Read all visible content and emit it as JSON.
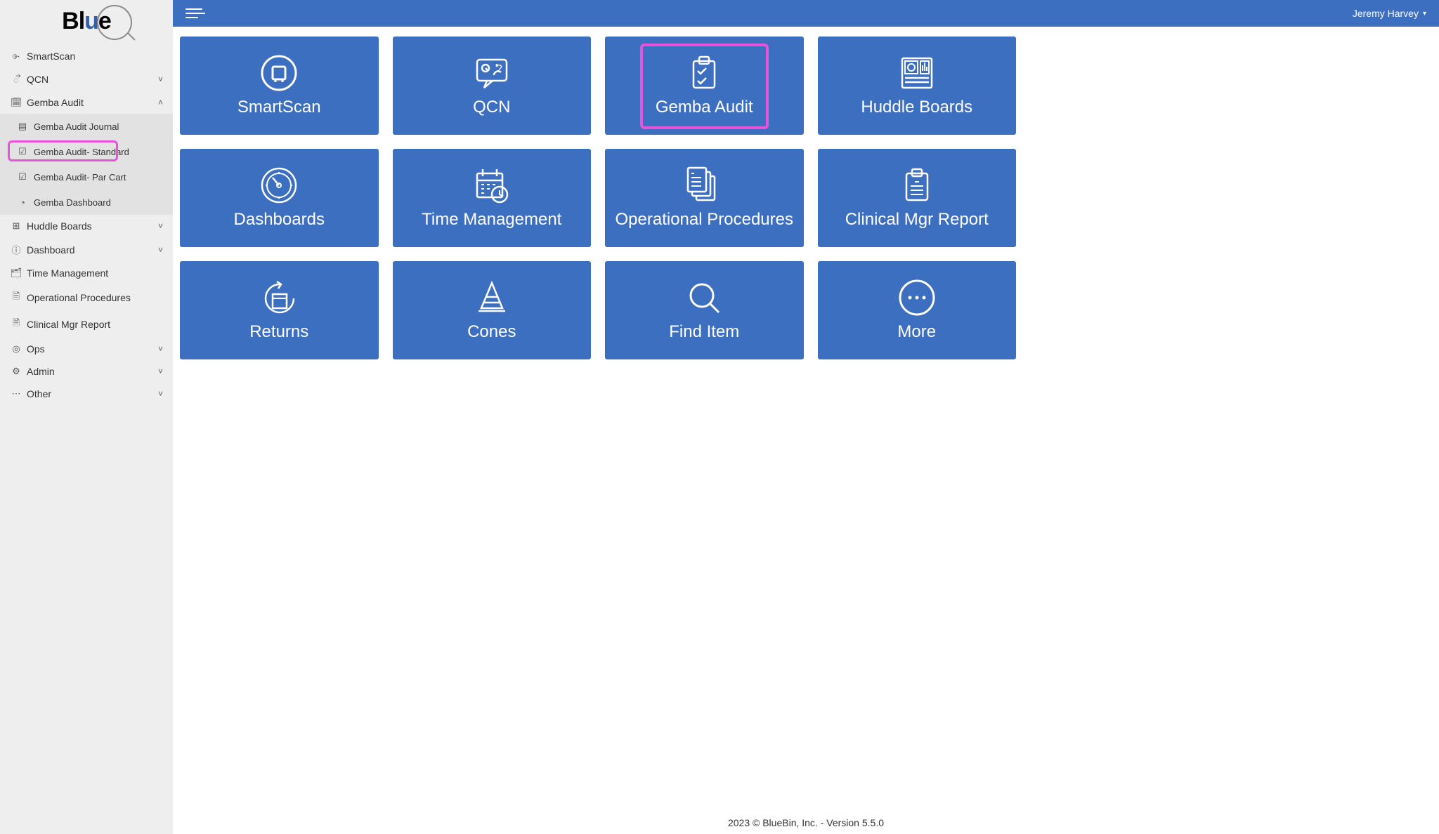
{
  "brand": {
    "name": "Blue"
  },
  "header": {
    "user_name": "Jeremy Harvey"
  },
  "sidebar": {
    "items": [
      {
        "label": "SmartScan",
        "icon": "⌱",
        "expandable": false
      },
      {
        "label": "QCN",
        "icon": "ᯭ",
        "expandable": true,
        "open": false
      },
      {
        "label": "Gemba Audit",
        "icon": "🗓",
        "expandable": true,
        "open": true,
        "children": [
          {
            "label": "Gemba Audit Journal",
            "icon": "▤"
          },
          {
            "label": "Gemba Audit- Standard",
            "icon": "☑",
            "highlight": true
          },
          {
            "label": "Gemba Audit- Par Cart",
            "icon": "☑"
          },
          {
            "label": "Gemba Dashboard",
            "icon": "◔"
          }
        ]
      },
      {
        "label": "Huddle Boards",
        "icon": "⊞",
        "expandable": true,
        "open": false
      },
      {
        "label": "Dashboard",
        "icon": "ⓘ",
        "expandable": true,
        "open": false
      },
      {
        "label": "Time Management",
        "icon": "🗂",
        "expandable": false
      },
      {
        "label": "Operational Procedures",
        "icon": "🗎",
        "expandable": false
      },
      {
        "label": "Clinical Mgr Report",
        "icon": "🗎",
        "expandable": false
      },
      {
        "label": "Ops",
        "icon": "◎",
        "expandable": true,
        "open": false
      },
      {
        "label": "Admin",
        "icon": "⚙",
        "expandable": true,
        "open": false
      },
      {
        "label": "Other",
        "icon": "⋯",
        "expandable": true,
        "open": false
      }
    ]
  },
  "tiles": [
    {
      "label": "SmartScan",
      "icon": "smartscan",
      "highlight": false
    },
    {
      "label": "QCN",
      "icon": "qcn",
      "highlight": false
    },
    {
      "label": "Gemba Audit",
      "icon": "gemba",
      "highlight": true
    },
    {
      "label": "Huddle Boards",
      "icon": "huddle",
      "highlight": false
    },
    {
      "label": "Dashboards",
      "icon": "gauge",
      "highlight": false
    },
    {
      "label": "Time Management",
      "icon": "calendar",
      "highlight": false
    },
    {
      "label": "Operational Procedures",
      "icon": "docs",
      "highlight": false
    },
    {
      "label": "Clinical Mgr Report",
      "icon": "clipboard",
      "highlight": false
    },
    {
      "label": "Returns",
      "icon": "returns",
      "highlight": false
    },
    {
      "label": "Cones",
      "icon": "cone",
      "highlight": false
    },
    {
      "label": "Find Item",
      "icon": "search",
      "highlight": false
    },
    {
      "label": "More",
      "icon": "more",
      "highlight": false
    }
  ],
  "footer": "2023 © BlueBin, Inc. - Version 5.5.0"
}
